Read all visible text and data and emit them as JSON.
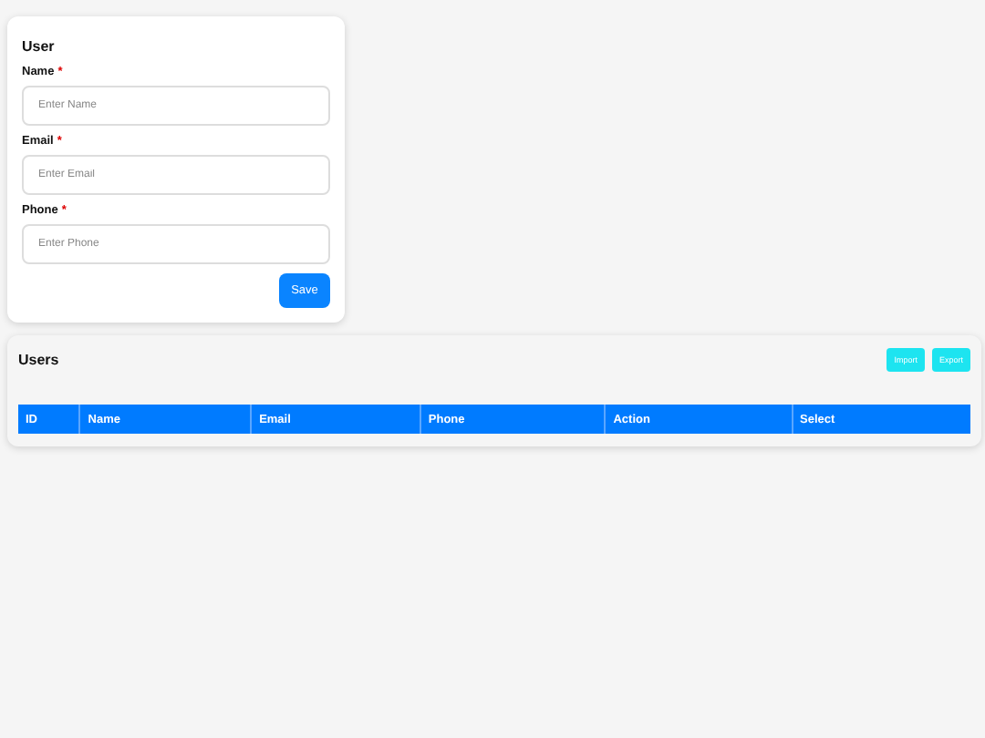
{
  "form": {
    "title": "User",
    "fields": [
      {
        "label": "Name",
        "required_mark": "*",
        "placeholder": "Enter Name"
      },
      {
        "label": "Email",
        "required_mark": "*",
        "placeholder": "Enter Email"
      },
      {
        "label": "Phone",
        "required_mark": "*",
        "placeholder": "Enter Phone"
      }
    ],
    "submit": "Save"
  },
  "users": {
    "title": "Users",
    "buttons": [
      "Import",
      "Export"
    ],
    "table": {
      "columns": [
        "ID",
        "Name",
        "Email",
        "Phone",
        "Action",
        "Select"
      ]
    }
  }
}
